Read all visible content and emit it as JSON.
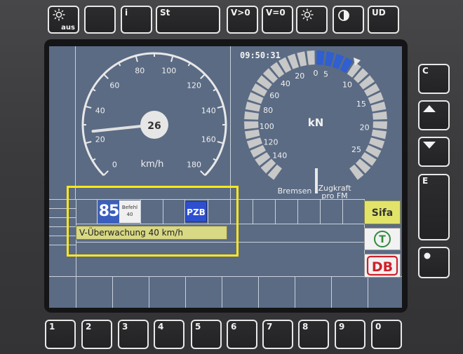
{
  "top_keys": [
    {
      "label": "☼",
      "sub": "aus",
      "icon": "sun-icon"
    },
    {
      "label": "",
      "sub": "",
      "icon": ""
    },
    {
      "label": "i",
      "sub": "",
      "icon": ""
    },
    {
      "label": "St",
      "sub": "",
      "icon": ""
    },
    {
      "label": "V>0",
      "sub": "",
      "icon": ""
    },
    {
      "label": "V=0",
      "sub": "",
      "icon": ""
    },
    {
      "label": "☼",
      "sub": "",
      "icon": "sun-icon"
    },
    {
      "label": "",
      "sub": "",
      "icon": "contrast-icon"
    },
    {
      "label": "UD",
      "sub": "",
      "icon": ""
    }
  ],
  "side_keys": [
    {
      "label": "C",
      "icon": ""
    },
    {
      "label": "",
      "icon": "triangle-up-icon"
    },
    {
      "label": "",
      "icon": "triangle-down-icon"
    },
    {
      "label": "E",
      "icon": ""
    },
    {
      "label": "",
      "icon": "dot-icon"
    }
  ],
  "bottom_keys": [
    "1",
    "2",
    "3",
    "4",
    "5",
    "6",
    "7",
    "8",
    "9",
    "0"
  ],
  "clock": "09:50:31",
  "speedometer": {
    "ticks": [
      "0",
      "20",
      "40",
      "60",
      "80",
      "100",
      "120",
      "140",
      "160",
      "180"
    ],
    "current_speed": "26",
    "current_speed_value": 26,
    "unit": "km/h",
    "max": 180
  },
  "force_gauge": {
    "unit": "kN",
    "brake_ticks": [
      "0",
      "20",
      "40",
      "60",
      "80",
      "100",
      "120",
      "140"
    ],
    "traction_ticks": [
      "5",
      "10",
      "15",
      "20",
      "25"
    ],
    "label_brake": "Bremsen",
    "label_traction": "Zugkraft",
    "label_traction_sub": "pro FM",
    "active_color": "#2f5fd0",
    "inactive_color": "#c8c8c8"
  },
  "indicators": {
    "speed_limit": "85",
    "befehl_label": "Befehl",
    "befehl_value": "40",
    "pzb": "PZB",
    "sifa": "Sifa",
    "t_symbol": "T",
    "db_logo": "DB"
  },
  "message": "V-Überwachung 40 km/h",
  "colors": {
    "screen_bg": "#5b6b84",
    "highlight": "#ffe81a",
    "message_bg": "#d8d885"
  }
}
